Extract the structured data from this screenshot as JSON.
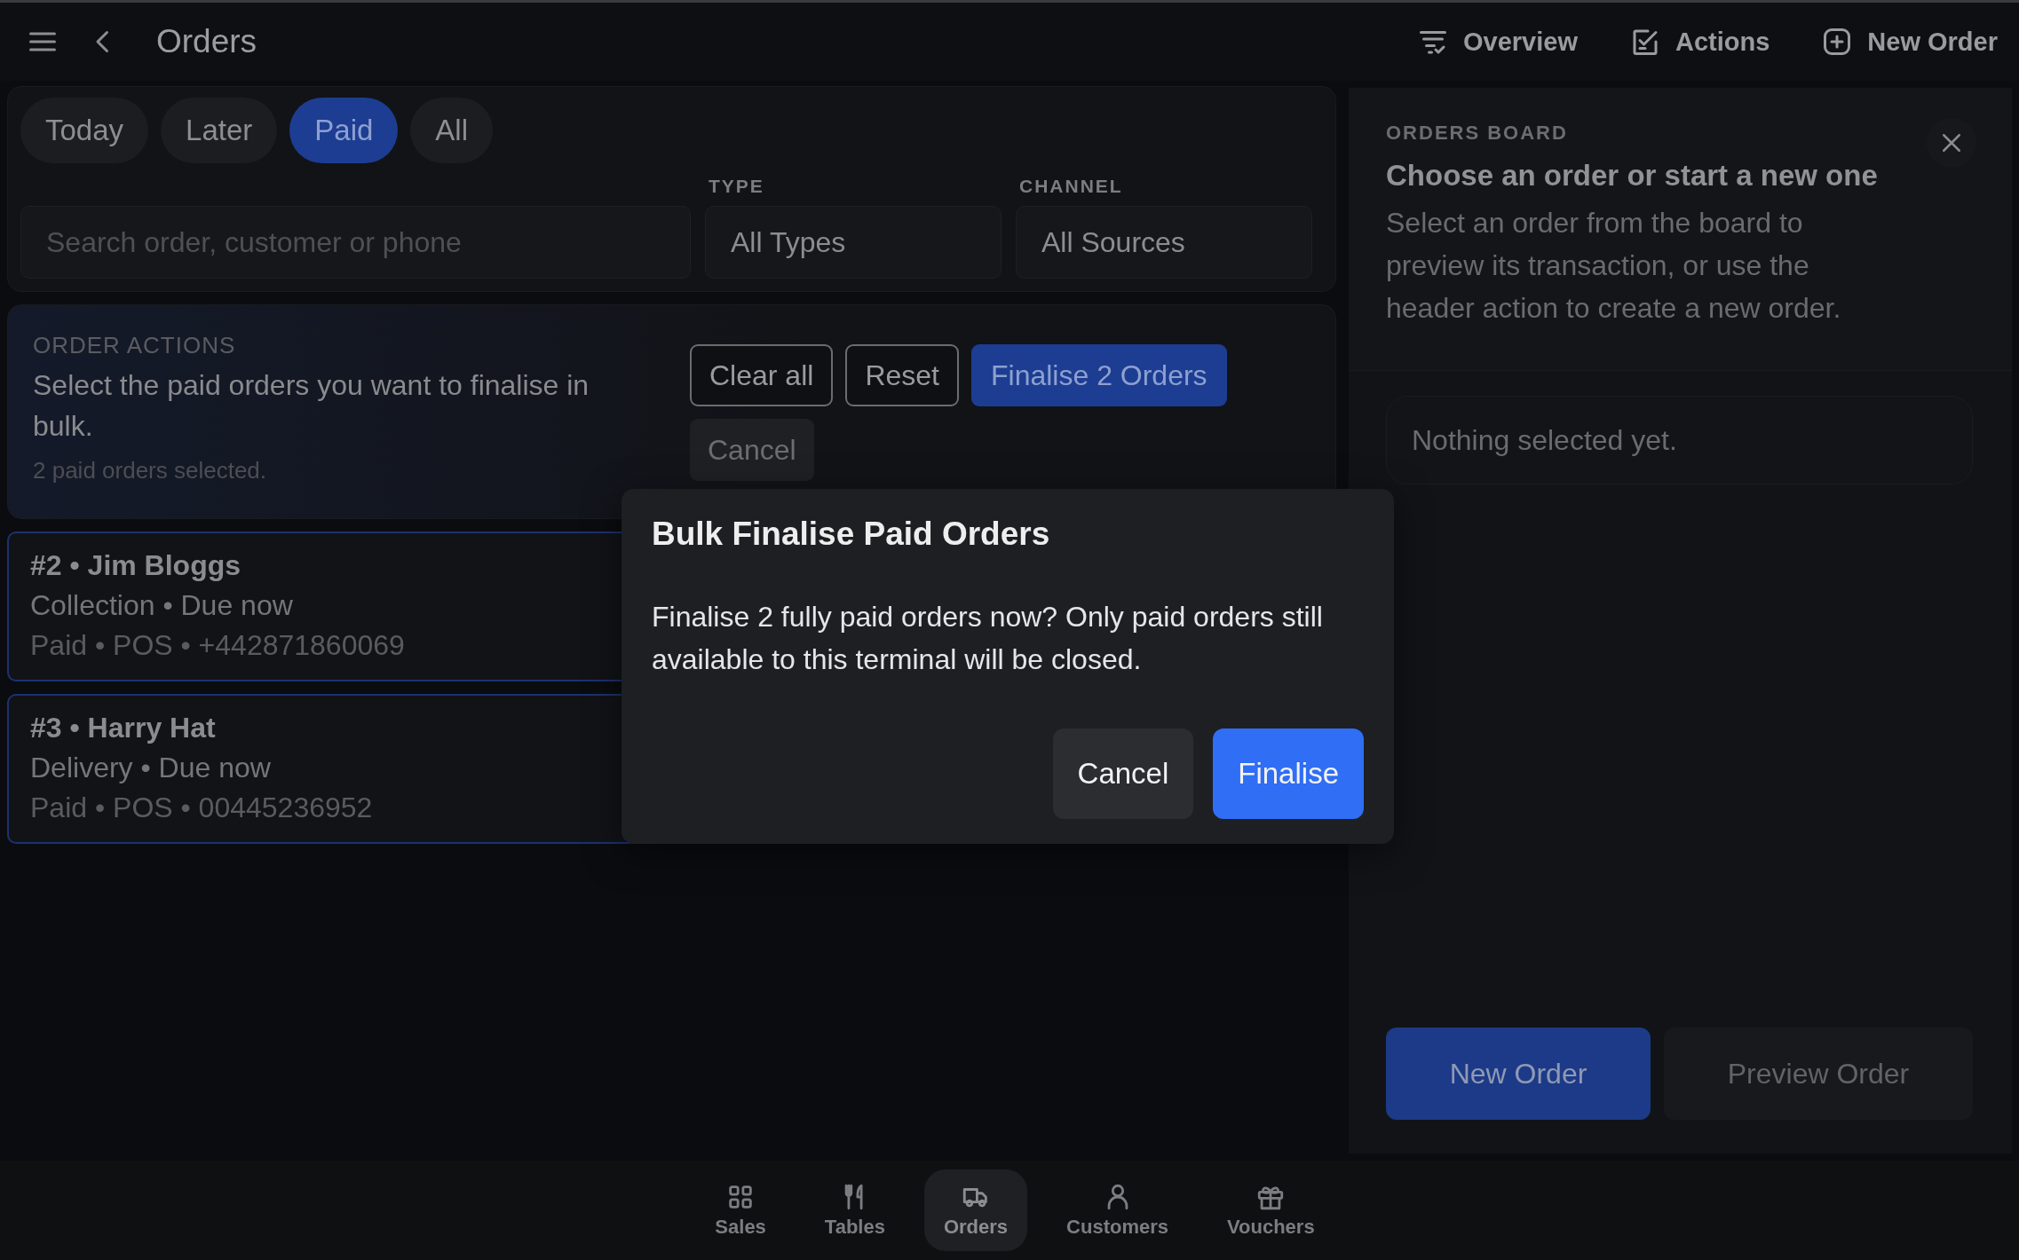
{
  "header": {
    "title": "Orders",
    "actions": [
      {
        "label": "Overview"
      },
      {
        "label": "Actions"
      },
      {
        "label": "New Order"
      }
    ]
  },
  "filters": {
    "tabs": [
      {
        "label": "Today",
        "selected": false
      },
      {
        "label": "Later",
        "selected": false
      },
      {
        "label": "Paid",
        "selected": true
      },
      {
        "label": "All",
        "selected": false
      }
    ],
    "search": {
      "placeholder": "Search order, customer or phone"
    },
    "selects": [
      {
        "label": "TYPE",
        "value": "All Types"
      },
      {
        "label": "CHANNEL",
        "value": "All Sources"
      }
    ]
  },
  "order_actions": {
    "heading": "ORDER ACTIONS",
    "description": "Select the paid orders you want to finalise in bulk.",
    "count": "2 paid orders selected.",
    "buttons": [
      {
        "label": "Clear all",
        "kind": "outline"
      },
      {
        "label": "Reset",
        "kind": "outline"
      },
      {
        "label": "Finalise 2 Orders",
        "kind": "primary"
      },
      {
        "label": "Cancel",
        "kind": "ghost"
      }
    ]
  },
  "orders": [
    {
      "title": "#2 • Jim Bloggs",
      "line_2": "Collection • Due now",
      "line_3": "Paid • POS • +442871860069",
      "selected": true
    },
    {
      "title": "#3 • Harry Hat",
      "line_2": "Delivery • Due now",
      "line_3": "Paid • POS • 00445236952",
      "selected": true
    }
  ],
  "board": {
    "eyebrow": "ORDERS BOARD",
    "heading": "Choose an order or start a new one",
    "description": "Select an order from the board to preview its transaction, or use the header action to create a new order.",
    "empty_text": "Nothing selected yet.",
    "buttons": [
      {
        "label": "New Order",
        "kind": "primary"
      },
      {
        "label": "Preview Order",
        "kind": "secondary"
      }
    ]
  },
  "nav": [
    {
      "label": "Sales",
      "selected": false
    },
    {
      "label": "Tables",
      "selected": false
    },
    {
      "label": "Orders",
      "selected": true
    },
    {
      "label": "Customers",
      "selected": false
    },
    {
      "label": "Vouchers",
      "selected": false
    }
  ],
  "dialog": {
    "title": "Bulk Finalise Paid Orders",
    "message": "Finalise 2 fully paid orders now? Only paid orders still available to this terminal will be closed.",
    "buttons": [
      {
        "label": "Cancel",
        "kind": "secondary"
      },
      {
        "label": "Finalise",
        "kind": "primary"
      }
    ]
  }
}
